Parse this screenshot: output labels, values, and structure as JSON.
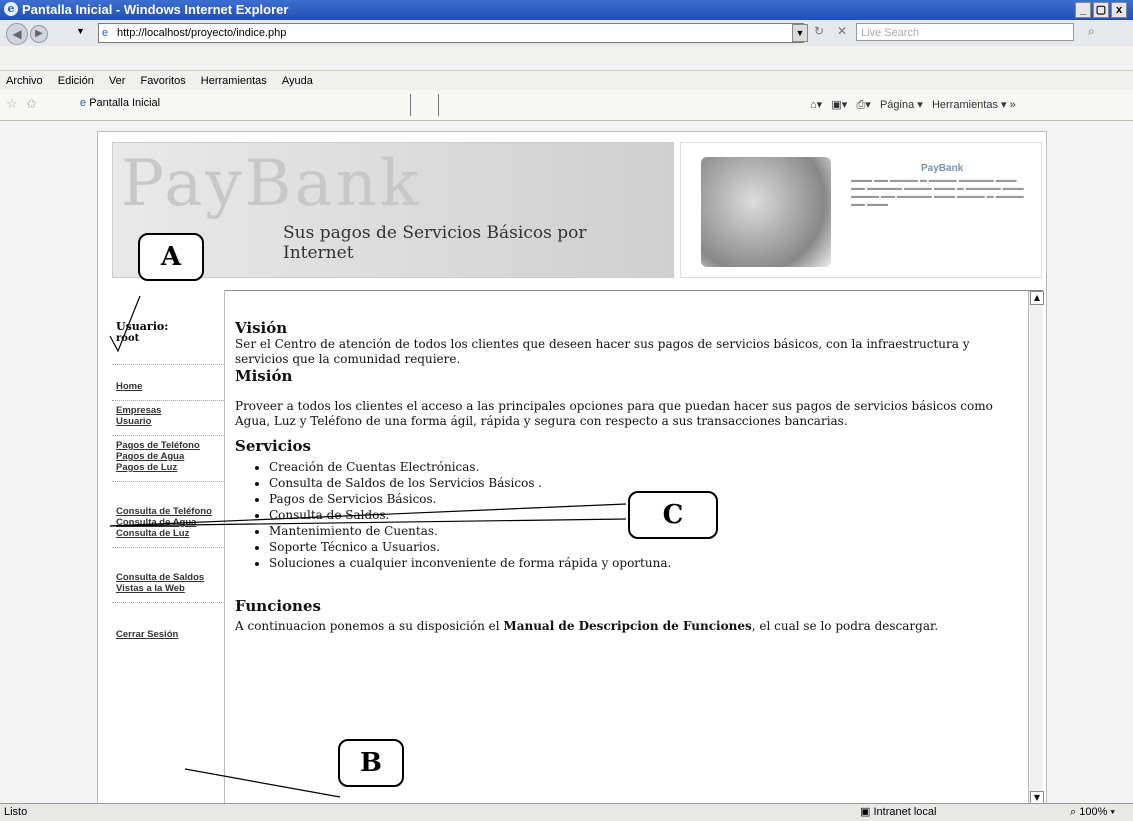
{
  "window": {
    "title": "Pantalla Inicial - Windows Internet Explorer",
    "buttons": [
      "_",
      "▢",
      "x"
    ]
  },
  "address_bar": {
    "url": "http://localhost/proyecto/indice.php",
    "search_placeholder": "Live Search"
  },
  "menu": [
    "Archivo",
    "Edición",
    "Ver",
    "Favoritos",
    "Herramientas",
    "Ayuda"
  ],
  "tab": {
    "label": "Pantalla Inicial"
  },
  "toolbar_right": {
    "pagina": "Página",
    "herramientas": "Herramientas"
  },
  "banner": {
    "logo": "PayBank",
    "tagline": "Sus pagos de Servicios Básicos por Internet"
  },
  "promo": {
    "brand": "PayBank"
  },
  "sidebar": {
    "user_label": "Usuario:",
    "user_value": "root",
    "groups": [
      [
        "Home"
      ],
      [
        "Empresas",
        "Usuario"
      ],
      [
        "Pagos de Teléfono",
        "Pagos de Agua",
        "Pagos de Luz"
      ],
      [
        "Consulta de Teléfono",
        "Consulta de Agua",
        "Consulta de Luz"
      ],
      [
        "Consulta de Saldos",
        "Vistas a la Web"
      ],
      [
        "Cerrar Sesión"
      ]
    ]
  },
  "main": {
    "vision_title": "Visión",
    "vision_text": "Ser el Centro de atención de todos los clientes que deseen hacer sus pagos de servicios básicos, con la infraestructura y servicios que la comunidad requiere.",
    "mision_title": "Misión",
    "mision_text": "Proveer a todos los clientes el acceso a las principales opciones para que puedan hacer sus pagos de servicios básicos como Agua, Luz y Teléfono de una forma ágil, rápida y segura con respecto a sus transacciones bancarias.",
    "servicios_title": "Servicios",
    "servicios": [
      "Creación de Cuentas Electrónicas.",
      "Consulta de Saldos de los Servicios Básicos .",
      "Pagos de Servicios Básicos.",
      "Consulta de Saldos.",
      "Mantenimiento de Cuentas.",
      "Soporte Técnico a Usuarios.",
      "Soluciones a cualquier inconveniente de forma rápida y oportuna."
    ],
    "funciones_title": "Funciones",
    "funciones_pre": "A continuacion ponemos a su disposición el ",
    "funciones_bold": "Manual de Descripcion de Funciones",
    "funciones_post": ", el cual se lo podra descargar."
  },
  "callouts": {
    "a": "A",
    "b": "B",
    "c": "C"
  },
  "status": {
    "left": "Listo",
    "zone": "Intranet local",
    "zoom": "100%"
  }
}
